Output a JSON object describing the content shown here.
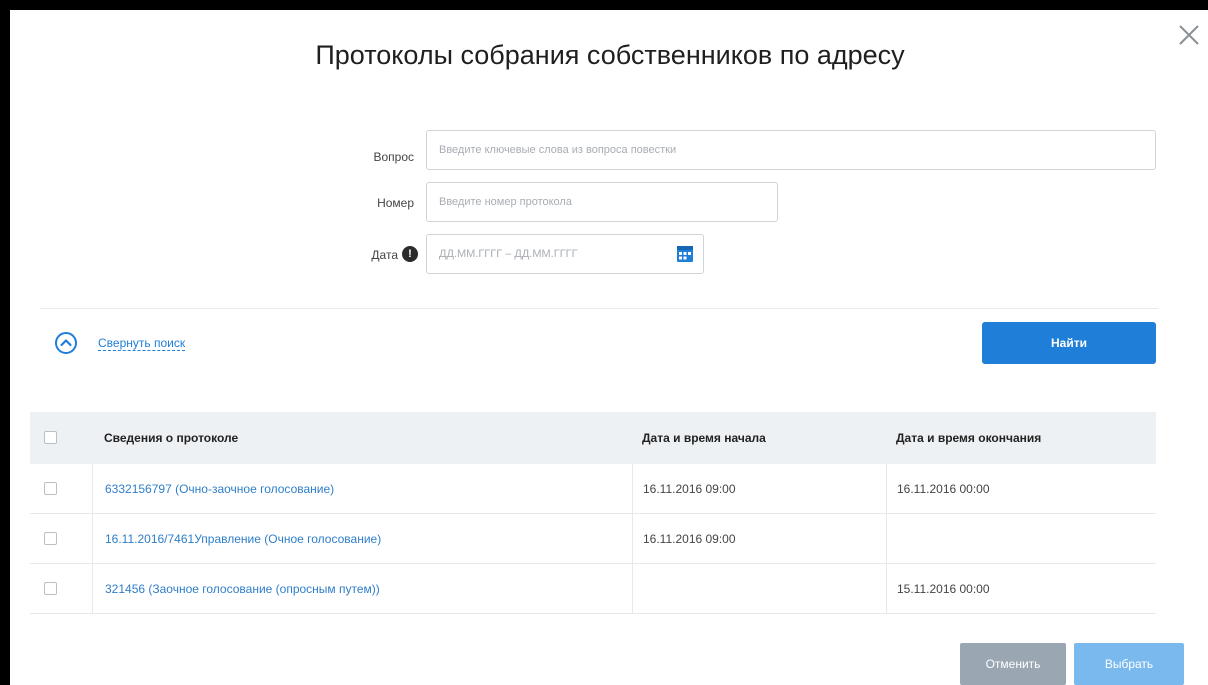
{
  "dialog": {
    "title": "Протоколы собрания собственников по адресу",
    "close_icon": "close-icon"
  },
  "search": {
    "question_label": "Вопрос",
    "question_placeholder": "Введите ключевые слова из вопроса повестки",
    "number_label": "Номер",
    "number_placeholder": "Введите номер протокола",
    "date_label": "Дата",
    "date_placeholder": "ДД.ММ.ГГГГ – ДД.ММ.ГГГГ",
    "info_icon": "info-icon",
    "calendar_icon": "calendar-icon",
    "collapse_label": "Свернуть поиск",
    "find_button": "Найти"
  },
  "table": {
    "columns": [
      "Сведения о протоколе",
      "Дата и время начала",
      "Дата и время окончания"
    ],
    "rows": [
      {
        "info": "6332156797 (Очно-заочное голосование)",
        "start": "16.11.2016 09:00",
        "end": "16.11.2016 00:00"
      },
      {
        "info": "16.11.2016/7461Управление (Очное голосование)",
        "start": "16.11.2016 09:00",
        "end": ""
      },
      {
        "info": "321456 (Заочное голосование (опросным путем))",
        "start": "",
        "end": "15.11.2016 00:00"
      }
    ]
  },
  "footer": {
    "cancel_button": "Отменить",
    "select_button": "Выбрать"
  },
  "colors": {
    "accent": "#1e7ed8",
    "link": "#2f7ec9",
    "cancel_bg": "#9aa7b3",
    "select_bg": "#79b9ee",
    "table_header_bg": "#eef1f4"
  }
}
